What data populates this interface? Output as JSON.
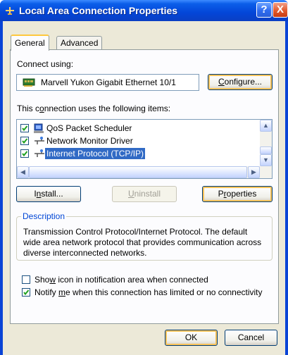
{
  "window": {
    "title": "Local Area Connection Properties",
    "help_label": "?",
    "close_label": "X"
  },
  "tabs": [
    {
      "label": "General",
      "selected": true
    },
    {
      "label": "Advanced",
      "selected": false
    }
  ],
  "general": {
    "connect_using_label": "Connect using:",
    "adapter_name": "Marvell Yukon Gigabit Ethernet 10/1",
    "configure_button": {
      "pre": "",
      "accel": "C",
      "post": "onfigure..."
    },
    "items_label": {
      "pre": "This c",
      "accel": "o",
      "post": "nnection uses the following items:"
    },
    "items": [
      {
        "label": "QoS Packet Scheduler",
        "checked": true,
        "selected": false,
        "icon": "qos-icon"
      },
      {
        "label": "Network Monitor Driver",
        "checked": true,
        "selected": false,
        "icon": "network-protocol-icon"
      },
      {
        "label": "Internet Protocol (TCP/IP)",
        "checked": true,
        "selected": true,
        "icon": "network-protocol-icon"
      }
    ],
    "install_button": {
      "pre": "I",
      "accel": "n",
      "post": "stall..."
    },
    "uninstall_button": {
      "pre": "",
      "accel": "U",
      "post": "ninstall"
    },
    "properties_button": {
      "pre": "P",
      "accel": "r",
      "post": "operties"
    },
    "description_title": "Description",
    "description_text": "Transmission Control Protocol/Internet Protocol. The default wide area network protocol that provides communication across diverse interconnected networks.",
    "show_icon_option": {
      "pre": "Sho",
      "accel": "w",
      "post": " icon in notification area when connected",
      "checked": false
    },
    "notify_option": {
      "pre": "Notify ",
      "accel": "m",
      "post": "e when this connection has limited or no connectivity",
      "checked": true
    }
  },
  "footer": {
    "ok_label": "OK",
    "cancel_label": "Cancel"
  },
  "colors": {
    "titlebar": "#0346d8",
    "selection": "#316ac5",
    "dialog_bg": "#ece9d8"
  }
}
